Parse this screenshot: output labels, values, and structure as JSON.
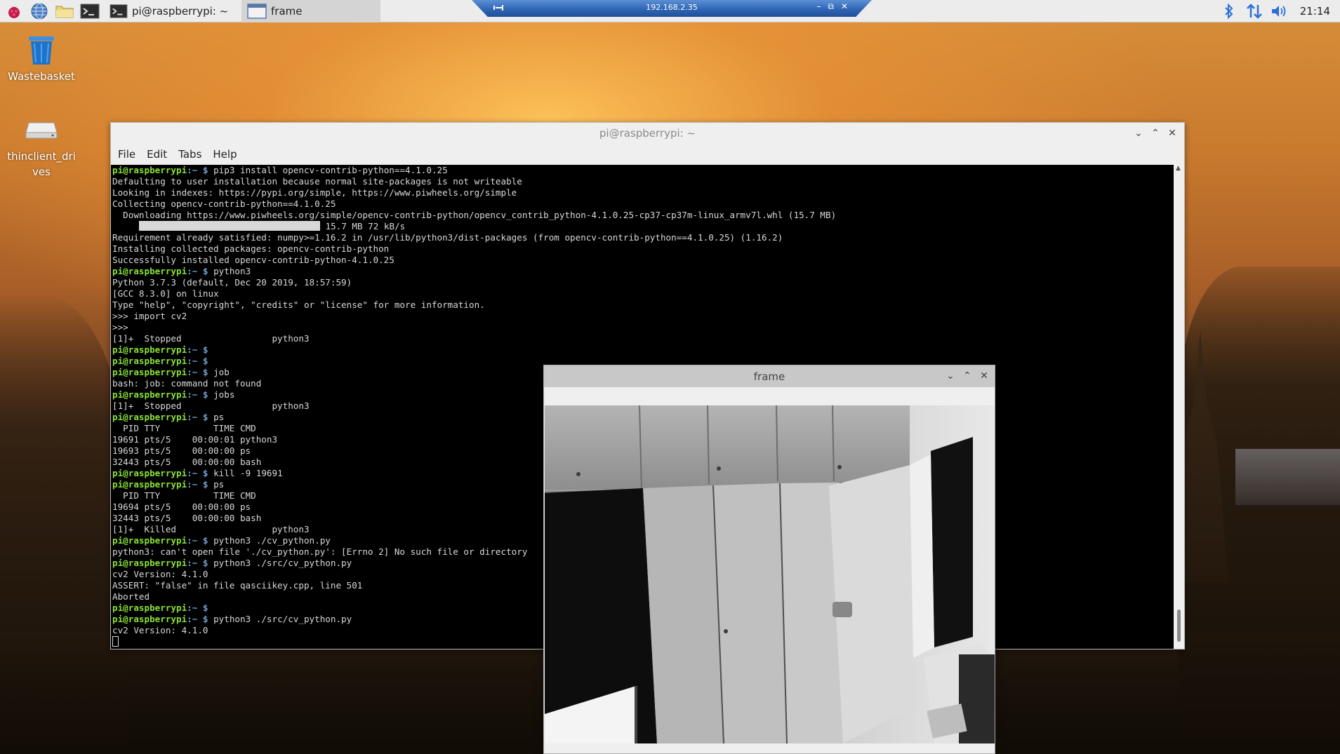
{
  "taskbar": {
    "tasks": [
      {
        "label": "pi@raspberrypi: ~"
      },
      {
        "label": "frame"
      }
    ],
    "clock": "21:14"
  },
  "remote_bar": {
    "title": "192.168.2.35"
  },
  "desktop": {
    "icons": [
      {
        "label": "Wastebasket"
      },
      {
        "label": "thinclient_drives"
      }
    ]
  },
  "terminal": {
    "title": "pi@raspberrypi: ~",
    "menu": [
      "File",
      "Edit",
      "Tabs",
      "Help"
    ],
    "prompt_user": "pi@raspberrypi",
    "prompt_path": ":~ $ ",
    "lines": [
      {
        "p": true,
        "t": "pip3 install opencv-contrib-python==4.1.0.25"
      },
      {
        "p": false,
        "t": "Defaulting to user installation because normal site-packages is not writeable"
      },
      {
        "p": false,
        "t": "Looking in indexes: https://pypi.org/simple, https://www.piwheels.org/simple"
      },
      {
        "p": false,
        "t": "Collecting opencv-contrib-python==4.1.0.25"
      },
      {
        "p": false,
        "t": "  Downloading https://www.piwheels.org/simple/opencv-contrib-python/opencv_contrib_python-4.1.0.25-cp37-cp37m-linux_armv7l.whl (15.7 MB)"
      },
      {
        "p": false,
        "bar": true,
        "t": " 15.7 MB 72 kB/s"
      },
      {
        "p": false,
        "t": "Requirement already satisfied: numpy>=1.16.2 in /usr/lib/python3/dist-packages (from opencv-contrib-python==4.1.0.25) (1.16.2)"
      },
      {
        "p": false,
        "t": "Installing collected packages: opencv-contrib-python"
      },
      {
        "p": false,
        "t": "Successfully installed opencv-contrib-python-4.1.0.25"
      },
      {
        "p": true,
        "t": "python3"
      },
      {
        "p": false,
        "t": "Python 3.7.3 (default, Dec 20 2019, 18:57:59)"
      },
      {
        "p": false,
        "t": "[GCC 8.3.0] on linux"
      },
      {
        "p": false,
        "t": "Type \"help\", \"copyright\", \"credits\" or \"license\" for more information."
      },
      {
        "p": false,
        "t": ">>> import cv2"
      },
      {
        "p": false,
        "t": ">>>"
      },
      {
        "p": false,
        "t": "[1]+  Stopped                 python3"
      },
      {
        "p": true,
        "t": ""
      },
      {
        "p": true,
        "t": ""
      },
      {
        "p": true,
        "t": "job"
      },
      {
        "p": false,
        "t": "bash: job: command not found"
      },
      {
        "p": true,
        "t": "jobs"
      },
      {
        "p": false,
        "t": "[1]+  Stopped                 python3"
      },
      {
        "p": true,
        "t": "ps"
      },
      {
        "p": false,
        "t": "  PID TTY          TIME CMD"
      },
      {
        "p": false,
        "t": "19691 pts/5    00:00:01 python3"
      },
      {
        "p": false,
        "t": "19693 pts/5    00:00:00 ps"
      },
      {
        "p": false,
        "t": "32443 pts/5    00:00:00 bash"
      },
      {
        "p": true,
        "t": "kill -9 19691"
      },
      {
        "p": true,
        "t": "ps"
      },
      {
        "p": false,
        "t": "  PID TTY          TIME CMD"
      },
      {
        "p": false,
        "t": "19694 pts/5    00:00:00 ps"
      },
      {
        "p": false,
        "t": "32443 pts/5    00:00:00 bash"
      },
      {
        "p": false,
        "t": "[1]+  Killed                  python3"
      },
      {
        "p": true,
        "t": "python3 ./cv_python.py"
      },
      {
        "p": false,
        "t": "python3: can't open file './cv_python.py': [Errno 2] No such file or directory"
      },
      {
        "p": true,
        "t": "python3 ./src/cv_python.py"
      },
      {
        "p": false,
        "t": "cv2 Version: 4.1.0"
      },
      {
        "p": false,
        "t": "ASSERT: \"false\" in file qasciikey.cpp, line 501"
      },
      {
        "p": false,
        "t": "Aborted"
      },
      {
        "p": true,
        "t": ""
      },
      {
        "p": true,
        "t": "python3 ./src/cv_python.py"
      },
      {
        "p": false,
        "t": "cv2 Version: 4.1.0"
      },
      {
        "p": false,
        "cursor": true,
        "t": ""
      }
    ]
  },
  "frame_window": {
    "title": "frame"
  },
  "colors": {
    "prompt_user": "#8ae234",
    "prompt_path": "#729fcf",
    "terminal_bg": "#000000",
    "terminal_fg": "#d8d8d8",
    "taskbar_bg": "#ececec"
  },
  "icons": {
    "menu": "raspberry-pi-logo",
    "browser": "globe-icon",
    "files": "folder-icon",
    "terminal": "terminal-icon",
    "tray": [
      "bluetooth-icon",
      "network-arrows-icon",
      "volume-icon"
    ]
  }
}
